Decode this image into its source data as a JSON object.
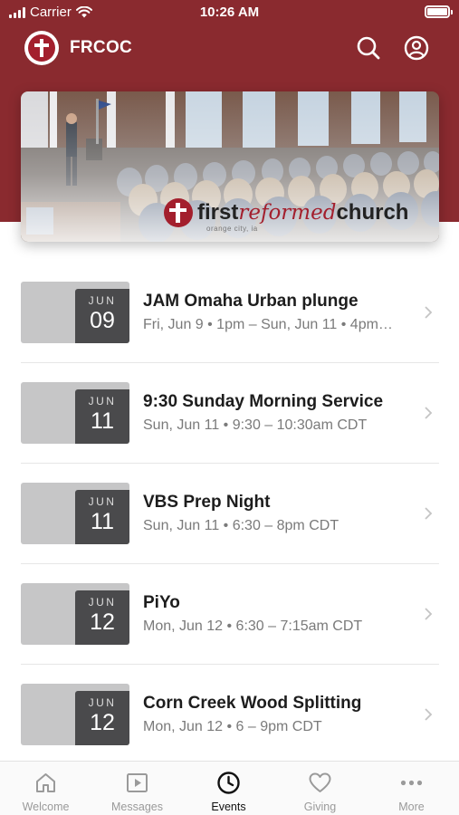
{
  "status_bar": {
    "carrier": "Carrier",
    "time": "10:26 AM"
  },
  "app": {
    "title": "FRCOC"
  },
  "hero": {
    "brand_first": "first",
    "brand_script": "reformed",
    "brand_last": "church",
    "brand_sub": "orange city, ia"
  },
  "events": [
    {
      "month": "JUN",
      "day": "09",
      "title": "JAM Omaha Urban plunge",
      "subtitle": "Fri, Jun 9 • 1pm – Sun, Jun 11 • 4pm…"
    },
    {
      "month": "JUN",
      "day": "11",
      "title": "9:30 Sunday Morning Service",
      "subtitle": "Sun, Jun 11 • 9:30 – 10:30am CDT"
    },
    {
      "month": "JUN",
      "day": "11",
      "title": "VBS Prep Night",
      "subtitle": "Sun, Jun 11 • 6:30 – 8pm CDT"
    },
    {
      "month": "JUN",
      "day": "12",
      "title": "PiYo",
      "subtitle": "Mon, Jun 12 • 6:30 – 7:15am CDT"
    },
    {
      "month": "JUN",
      "day": "12",
      "title": "Corn Creek Wood Splitting",
      "subtitle": "Mon, Jun 12 • 6 – 9pm CDT"
    }
  ],
  "tabs": [
    {
      "label": "Welcome",
      "icon": "home-icon"
    },
    {
      "label": "Messages",
      "icon": "play-icon"
    },
    {
      "label": "Events",
      "icon": "clock-icon"
    },
    {
      "label": "Giving",
      "icon": "heart-icon"
    },
    {
      "label": "More",
      "icon": "more-icon"
    }
  ],
  "colors": {
    "brand": "#8a2a2f",
    "accent": "#a31f2d",
    "date_badge": "#4a4a4c"
  }
}
